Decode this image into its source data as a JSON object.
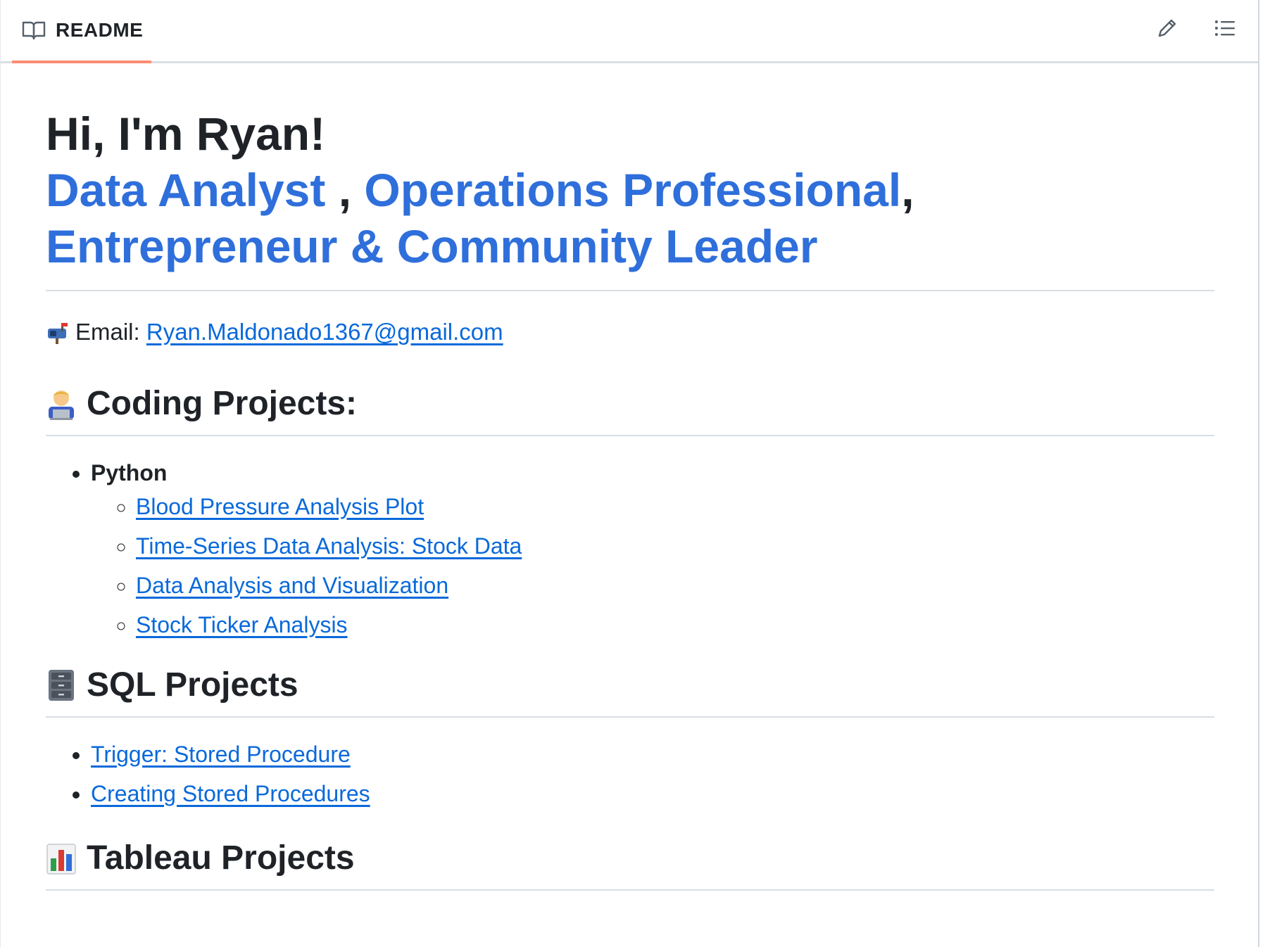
{
  "header": {
    "tab_label": "README",
    "tab_accent": "#fd8c73",
    "icons": [
      "book-icon",
      "pencil-icon",
      "list-icon"
    ]
  },
  "intro": {
    "greeting": "Hi, I'm Ryan!",
    "roles": [
      "Data Analyst",
      "Operations Professional",
      "Entrepreneur & Community Leader"
    ],
    "separator_1": " ,",
    "separator_2": ","
  },
  "contact": {
    "emoji": "mailbox-icon",
    "label": "Email:",
    "email": "Ryan.Maldonado1367@gmail.com"
  },
  "sections": {
    "coding": {
      "icon": "technologist-icon",
      "title": "Coding Projects:",
      "group": "Python",
      "links": [
        "Blood Pressure Analysis Plot",
        "Time-Series Data Analysis: Stock Data",
        "Data Analysis and Visualization",
        "Stock Ticker Analysis"
      ]
    },
    "sql": {
      "icon": "file-cabinet-icon",
      "title": "SQL Projects",
      "links": [
        "Trigger: Stored Procedure",
        "Creating Stored Procedures"
      ]
    },
    "tableau": {
      "icon": "bar-chart-icon",
      "title": "Tableau Projects"
    }
  },
  "colors": {
    "link": "#0969da",
    "heading_link": "#2f6fdb",
    "text": "#1f2328",
    "divider": "#d8dee4"
  }
}
